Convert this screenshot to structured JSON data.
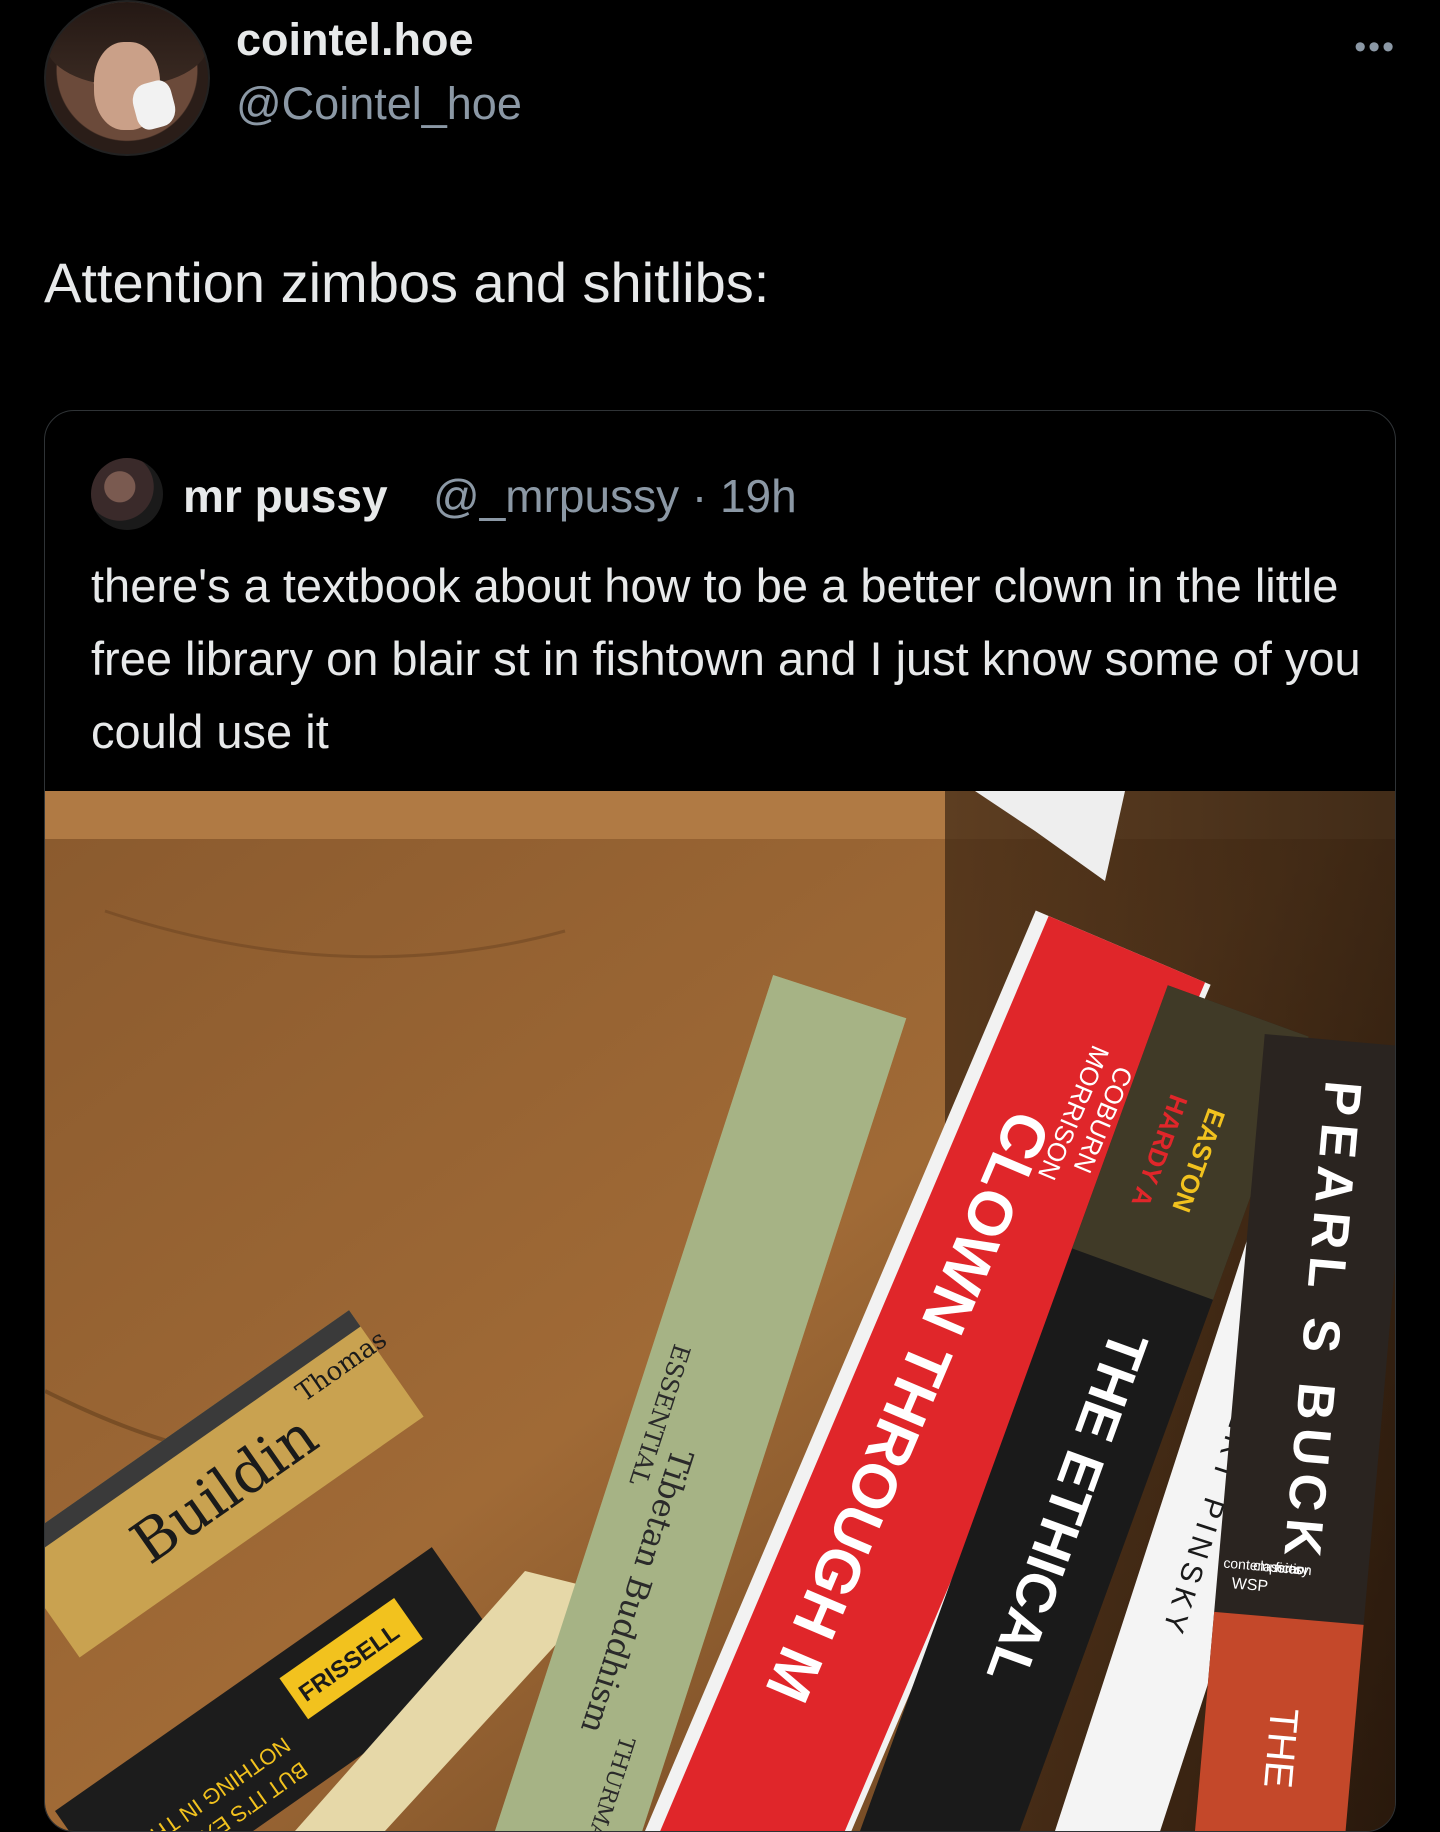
{
  "author": {
    "display_name": "cointel.hoe",
    "handle": "@Cointel_hoe"
  },
  "more_label": "•••",
  "tweet_text": "Attention zimbos and shitlibs:",
  "quoted": {
    "display_name": "mr pussy",
    "handle_time": "@_mrpussy · 19h",
    "text": "there's a textbook about how to be a better clown in the little free library on blair st in fishtown and I just know some of you could use it"
  },
  "photo": {
    "spines": {
      "coburn": "COBURN",
      "morrison": "MORRISON",
      "clown": "CLOWN THROUGH M",
      "hardy": "HARDY A",
      "easton": "EASTON",
      "ethical": "THE ETHICAL",
      "robert": "ROBERT PINSKY",
      "pearl": "PEARL S BUCK",
      "wsp": "WSP",
      "contemporary": "contemporary",
      "classics": "classics",
      "fiction": "fiction",
      "the": "THE",
      "essential": "ESSENTIAL",
      "tibetan": "Tibetan Buddhism",
      "thurman": "THURMAN",
      "thomas": "Thomas",
      "building": "Buildin",
      "frissell": "FRISSELL",
      "nothing": "NOTHING IN THIS BO",
      "exactly": "BUT IT'S EXACTLY"
    }
  }
}
